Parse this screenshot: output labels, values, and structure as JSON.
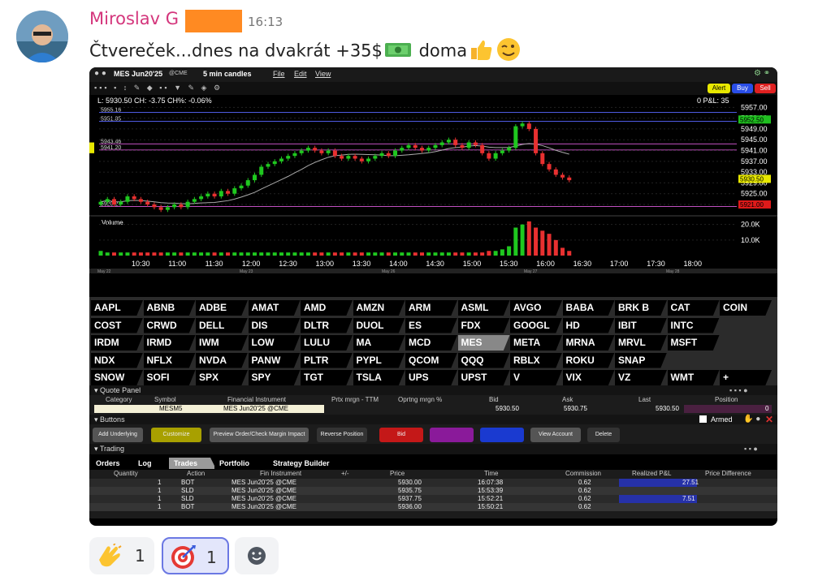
{
  "message": {
    "author": "Miroslav G",
    "time": "16:13",
    "text_before": "Čtvereček...dnes na dvakrát +35$",
    "text_after": "doma",
    "emoji_money": "money-with-wings-icon",
    "emoji_thumbs": "thumbs-up-icon",
    "emoji_wink": "winking-face-icon"
  },
  "platform": {
    "symbol_title": "MES Jun20'25",
    "exchange": "@CME",
    "interval": "5 min candles",
    "menu": [
      "File",
      "Edit",
      "View"
    ],
    "order_buttons": [
      "Alert",
      "Buy",
      "Sell"
    ],
    "info_line": "L: 5930.50 CH: -3.75 CH%: -0.06%",
    "pnl": "0 P&L: 35",
    "chart_data": {
      "type": "candlestick",
      "title": "MES Jun20'25 @CME",
      "x_ticks": [
        "10:30",
        "11:00",
        "11:30",
        "12:00",
        "12:30",
        "13:00",
        "13:30",
        "14:00",
        "14:30",
        "15:00",
        "15:30",
        "16:00",
        "16:30",
        "17:00",
        "17:30",
        "18:00"
      ],
      "y_ticks": [
        "5957.00",
        "5953.00",
        "5949.00",
        "5945.00",
        "5941.00",
        "5937.00",
        "5933.00",
        "5929.00",
        "5925.00",
        "5921.00"
      ],
      "ylim": [
        5918,
        5958
      ],
      "price_labels_left": [
        "5955.16",
        "5951.85",
        "5943.46",
        "5941.20",
        "5920.27"
      ],
      "price_tags_right": [
        {
          "value": "5952.50",
          "color": "#1fbf1f"
        },
        {
          "value": "5930.50",
          "color": "#e8e800"
        },
        {
          "value": "5921.00",
          "color": "#e01a1a"
        }
      ],
      "volume_label": "Volume",
      "volume_ticks": [
        "20.0K",
        "10.0K"
      ],
      "date_labels": [
        "May 22",
        "May 23",
        "May 26",
        "May 27",
        "May 28"
      ],
      "closes": [
        5922,
        5923,
        5921,
        5922,
        5924,
        5923,
        5922,
        5921,
        5920,
        5919,
        5920,
        5921,
        5920,
        5922,
        5923,
        5924,
        5925,
        5924,
        5926,
        5925,
        5927,
        5928,
        5930,
        5932,
        5935,
        5936,
        5937,
        5938,
        5939,
        5940,
        5941,
        5942,
        5941,
        5940,
        5941,
        5939,
        5938,
        5939,
        5938,
        5937,
        5938,
        5939,
        5940,
        5939,
        5941,
        5942,
        5943,
        5942,
        5941,
        5942,
        5943,
        5944,
        5945,
        5943,
        5942,
        5944,
        5943,
        5940,
        5938,
        5940,
        5941,
        5942,
        5950,
        5951,
        5949,
        5940,
        5936,
        5934,
        5932,
        5931,
        5930
      ],
      "volume": [
        3,
        2,
        2,
        2,
        2,
        2,
        2,
        2,
        2,
        2,
        2,
        2,
        2,
        2,
        2,
        2,
        2,
        2,
        2,
        2,
        2,
        2,
        2,
        2,
        2,
        2,
        2,
        2,
        2,
        2,
        2,
        2,
        2,
        2,
        2,
        2,
        2,
        2,
        2,
        2,
        2,
        2,
        2,
        2,
        2,
        2,
        2,
        2,
        2,
        2,
        2,
        2,
        2,
        2,
        2,
        2,
        2,
        2,
        3,
        3,
        4,
        6,
        18,
        20,
        22,
        18,
        16,
        14,
        10,
        5,
        3
      ]
    },
    "symbols": [
      [
        "AAPL",
        "ABNB",
        "ADBE",
        "AMAT",
        "AMD",
        "AMZN",
        "ARM",
        "ASML",
        "AVGO",
        "BABA",
        "BRK B",
        "CAT",
        "COIN"
      ],
      [
        "COST",
        "CRWD",
        "DELL",
        "DIS",
        "DLTR",
        "DUOL",
        "ES",
        "FDX",
        "GOOGL",
        "HD",
        "IBIT",
        "INTC"
      ],
      [
        "IRDM",
        "IRMD",
        "IWM",
        "LOW",
        "LULU",
        "MA",
        "MCD",
        "MES",
        "META",
        "MRNA",
        "MRVL",
        "MSFT"
      ],
      [
        "NDX",
        "NFLX",
        "NVDA",
        "PANW",
        "PLTR",
        "PYPL",
        "QCOM",
        "QQQ",
        "RBLX",
        "ROKU",
        "SNAP"
      ],
      [
        "SNOW",
        "SOFI",
        "SPX",
        "SPY",
        "TGT",
        "TSLA",
        "UPS",
        "UPST",
        "V",
        "VIX",
        "VZ",
        "WMT",
        "+"
      ]
    ],
    "quote_panel": {
      "title": "Quote Panel",
      "headers": [
        "Category",
        "Symbol",
        "Financial Instrument",
        "Prtx mrgn - TTM",
        "Oprtng mrgn %",
        "Bid",
        "Ask",
        "Last",
        "Position"
      ],
      "values": [
        "MESM5",
        "MES Jun20'25 @CME",
        "",
        "",
        "5930.50",
        "5930.75",
        "5930.50",
        "0"
      ]
    },
    "buttons_panel": {
      "title": "Buttons",
      "armed": "Armed",
      "labels": [
        "Add Underlying",
        "Customize",
        "Preview Order/Check Margin Impact",
        "Reverse Position",
        "Bid",
        "",
        "",
        "View Account",
        "Delete"
      ]
    },
    "trading": {
      "title": "Trading",
      "tabs": [
        "Orders",
        "Log",
        "Trades",
        "Portfolio",
        "Strategy Builder"
      ],
      "headers": [
        "Quantity",
        "Action",
        "Fin Instrument",
        "+/-",
        "Price",
        "Time",
        "Commission",
        "Realized P&L",
        "Price Difference"
      ],
      "rows": [
        [
          "1",
          "BOT",
          "MES Jun20'25 @CME",
          "5930.00",
          "16:07:38",
          "0.62",
          "27.51"
        ],
        [
          "1",
          "SLD",
          "MES Jun20'25 @CME",
          "5935.75",
          "15:53:39",
          "0.62",
          ""
        ],
        [
          "1",
          "SLD",
          "MES Jun20'25 @CME",
          "5937.75",
          "15:52:21",
          "0.62",
          "7.51"
        ],
        [
          "1",
          "BOT",
          "MES Jun20'25 @CME",
          "5936.00",
          "15:50:21",
          "0.62",
          ""
        ]
      ]
    }
  },
  "reactions": [
    {
      "icon": "clapping-hands-icon",
      "count": "1"
    },
    {
      "icon": "direct-hit-icon",
      "count": "1"
    }
  ]
}
